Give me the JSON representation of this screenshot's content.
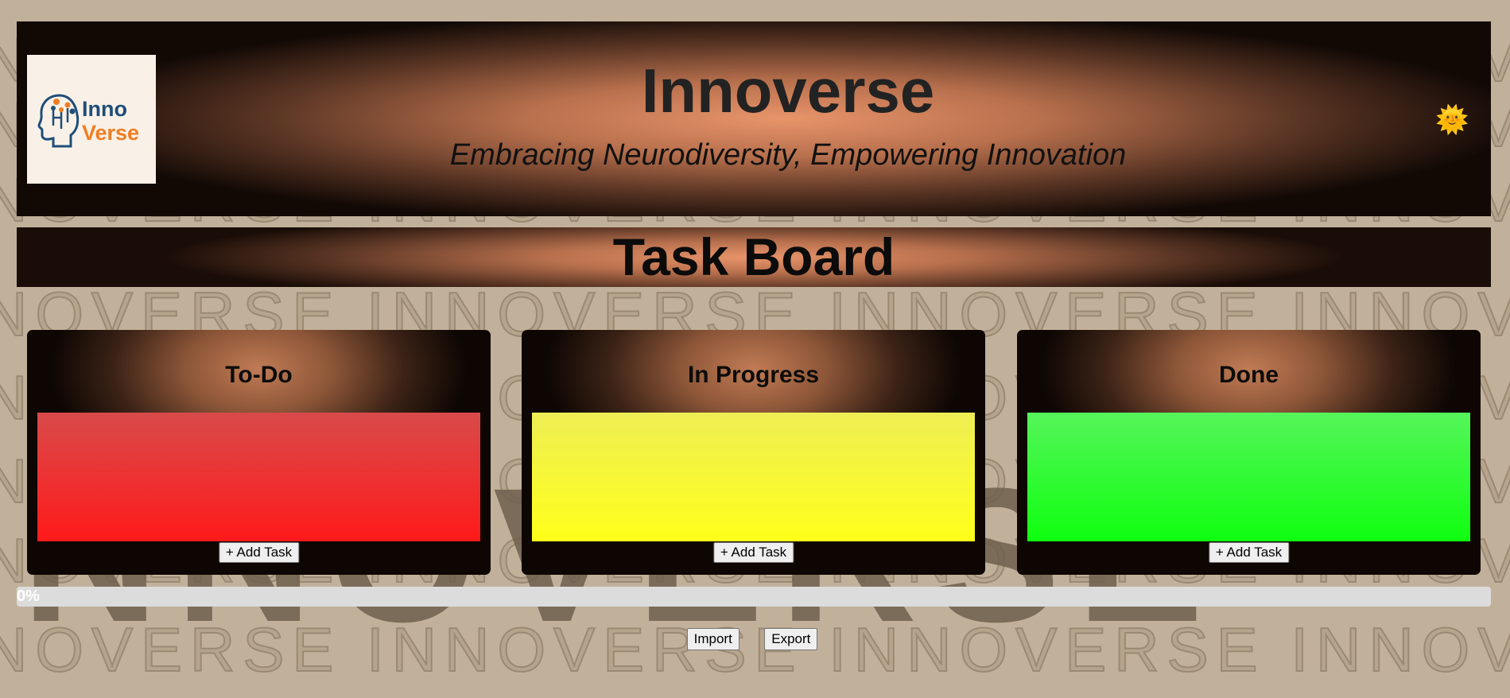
{
  "app": {
    "title": "Innoverse",
    "tagline": "Embracing Neurodiversity, Empowering Innovation",
    "logo": {
      "top_word": "Inno",
      "bottom_word": "Verse",
      "icon": "head-circuit-icon"
    },
    "theme_toggle_icon": "smiling-sun-icon",
    "theme_toggle_glyph": "🌞",
    "watermark_text": "INNOVERSE"
  },
  "board": {
    "title": "Task Board",
    "columns": [
      {
        "id": "todo",
        "title": "To-Do",
        "add_label": "+ Add Task",
        "color": "#ff1a1a"
      },
      {
        "id": "progress",
        "title": "In Progress",
        "add_label": "+ Add Task",
        "color": "#ffff1a"
      },
      {
        "id": "done",
        "title": "Done",
        "add_label": "+ Add Task",
        "color": "#0fff10"
      }
    ]
  },
  "progress": {
    "value_percent": 0,
    "label": "0%"
  },
  "actions": {
    "import_label": "Import",
    "export_label": "Export"
  },
  "colors": {
    "background": "#c2b19a",
    "header_glow": "#e8946a",
    "logo_blue": "#1f4e79",
    "logo_orange": "#f07d22"
  }
}
